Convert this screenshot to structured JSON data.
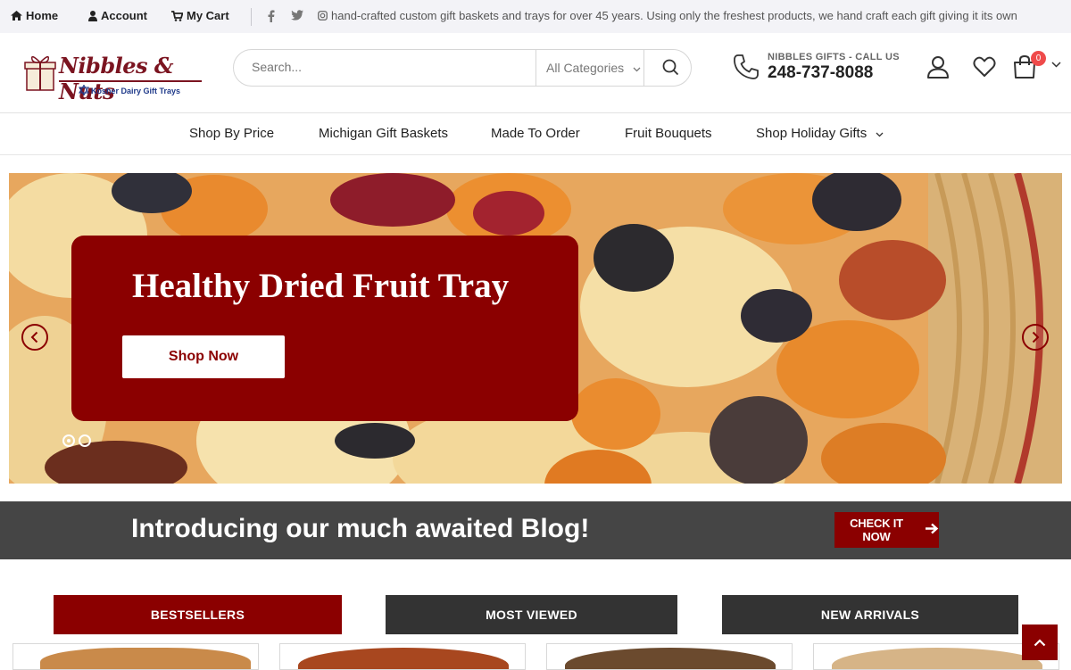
{
  "topbar": {
    "home": "Home",
    "account": "Account",
    "cart": "My Cart",
    "ticker": "hand-crafted custom gift baskets and trays for over 45 years. Using only the freshest products, we hand craft each gift giving it its own"
  },
  "header": {
    "logo_name": "Nibbles & Nuts",
    "logo_tagline": "Kosher Dairy Gift Trays",
    "search_placeholder": "Search...",
    "category_select": "All Categories",
    "call_label": "NIBBLES GIFTS - CALL US",
    "phone": "248-737-8088",
    "cart_count": "0"
  },
  "nav": {
    "items": [
      "Shop By Price",
      "Michigan Gift Baskets",
      "Made To Order",
      "Fruit Bouquets",
      "Shop Holiday Gifts"
    ]
  },
  "hero": {
    "title": "Healthy Dried Fruit Tray",
    "button": "Shop Now",
    "slide_count": 2,
    "active_slide": 1
  },
  "blog": {
    "text": "Introducing our much awaited Blog!",
    "button": "CHECK IT NOW"
  },
  "tabs": [
    "BESTSELLERS",
    "MOST VIEWED",
    "NEW ARRIVALS"
  ],
  "colors": {
    "brand_red": "#8b0000",
    "dark_gray": "#333333",
    "banner_gray": "#454545",
    "badge_red": "#ef4b4b"
  }
}
